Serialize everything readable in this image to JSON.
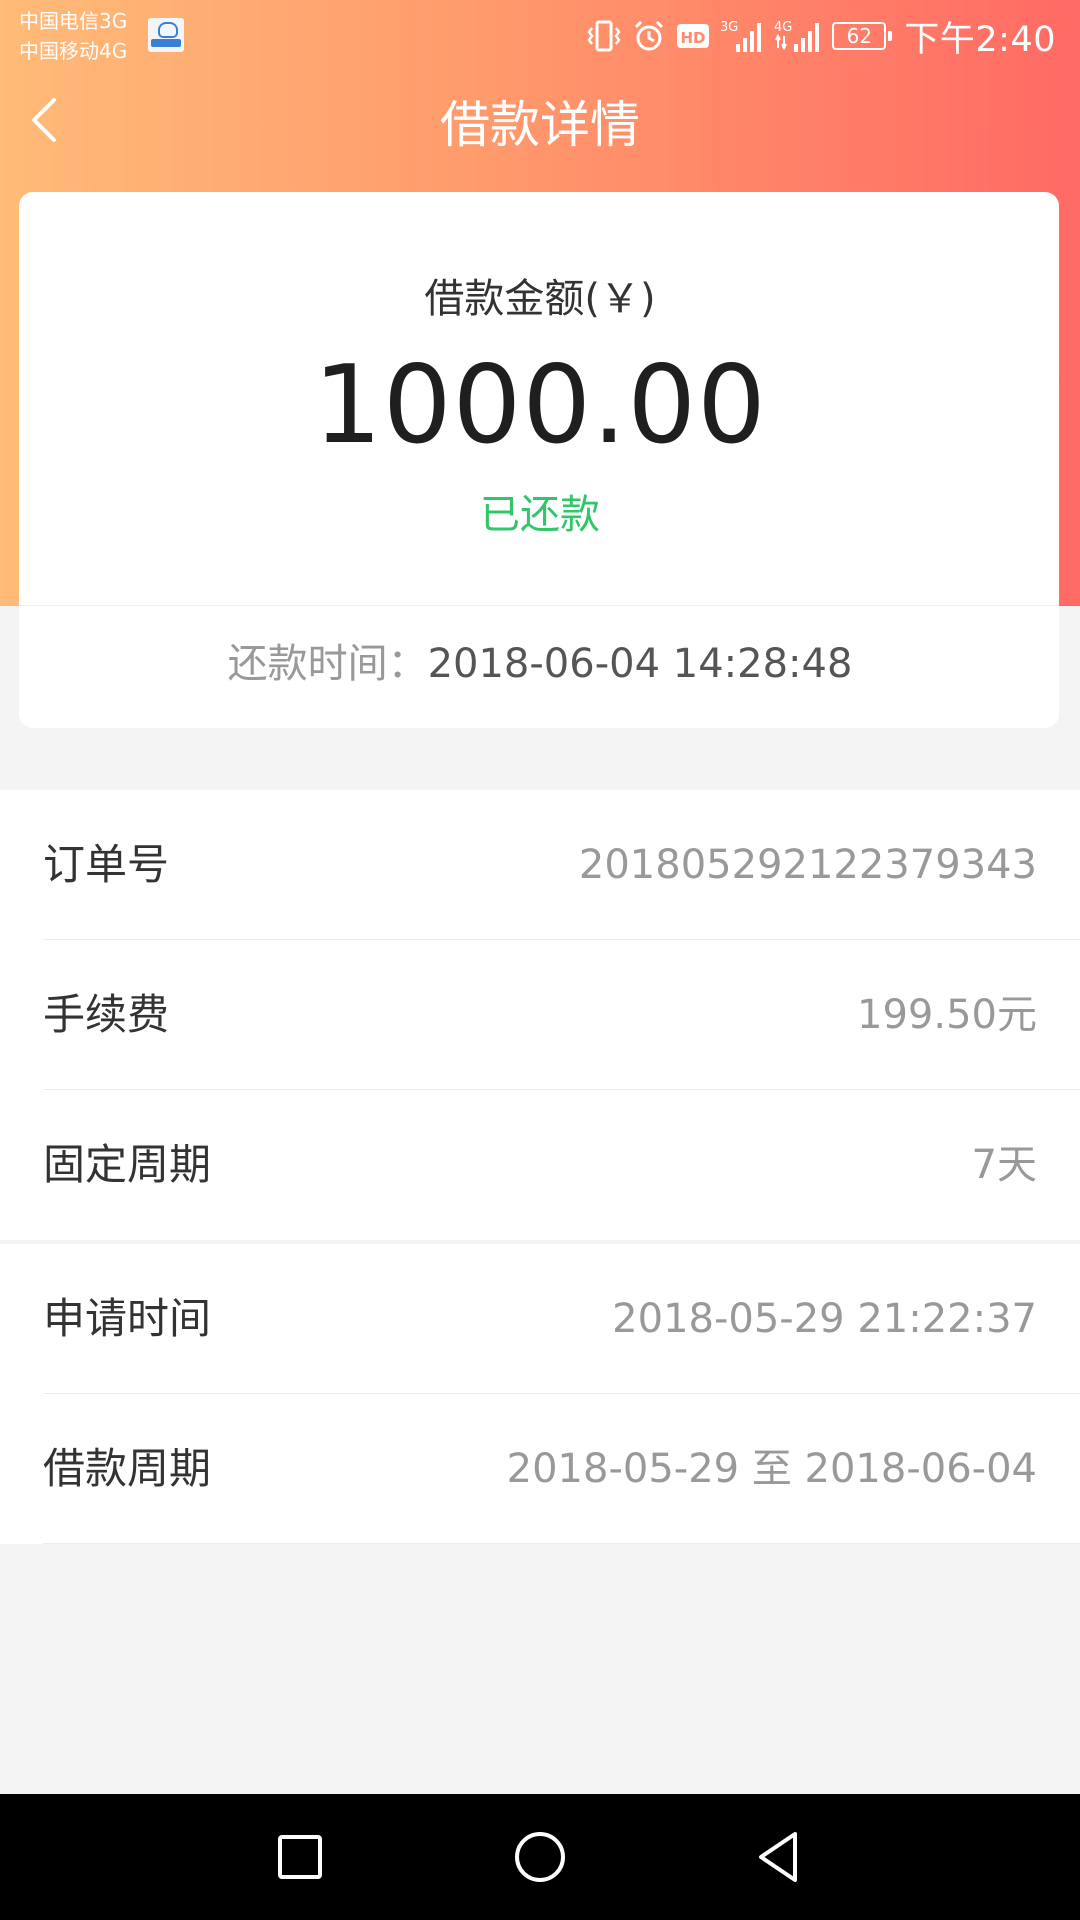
{
  "status_bar": {
    "carrier_1": "中国电信3G",
    "carrier_2": "中国移动4G",
    "network_1": "3G",
    "network_2": "4G",
    "battery": "62",
    "time": "下午2:40",
    "icons": [
      "app-notification-icon",
      "vibrate-icon",
      "alarm-icon",
      "hd-icon",
      "signal-3g-icon",
      "signal-4g-icon",
      "battery-icon"
    ]
  },
  "header": {
    "title": "借款详情",
    "back_icon": "chevron-left-icon"
  },
  "summary": {
    "amount_label": "借款金额(￥)",
    "amount": "1000.00",
    "status": "已还款",
    "repay_time_label": "还款时间：",
    "repay_time": "2018-06-04 14:28:48"
  },
  "details": [
    {
      "label": "订单号",
      "value": "201805292122379343"
    },
    {
      "label": "手续费",
      "value": "199.50元"
    },
    {
      "label": "固定周期",
      "value": "7天"
    },
    {
      "label": "申请时间",
      "value": "2018-05-29 21:22:37"
    },
    {
      "label": "借款周期",
      "value": "2018-05-29 至 2018-06-04"
    }
  ],
  "nav_bar": {
    "icons": [
      "recents-square-icon",
      "home-circle-icon",
      "back-triangle-icon"
    ]
  },
  "colors": {
    "gradient_start": "#ffbb78",
    "gradient_end": "#ff6a64",
    "status_green": "#2fc76a",
    "value_gray": "#999999"
  }
}
